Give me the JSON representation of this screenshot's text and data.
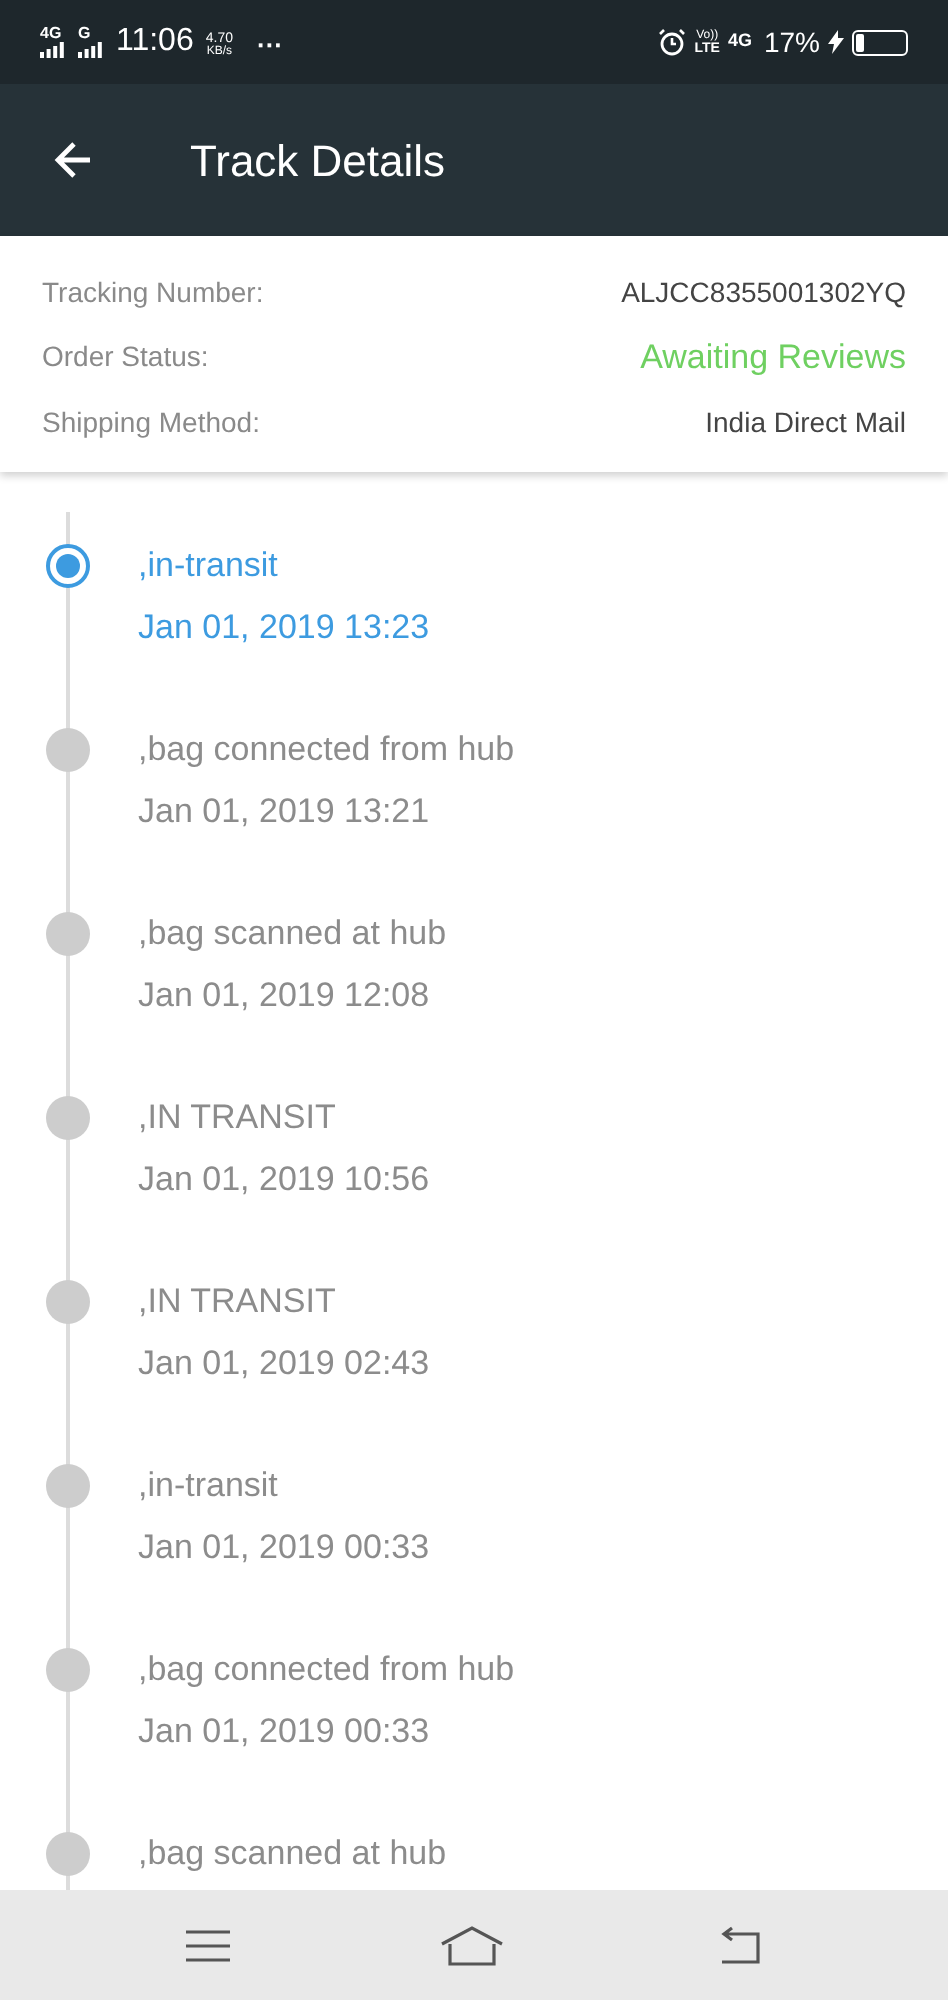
{
  "status_bar": {
    "sim1": "4G",
    "sim2": "G",
    "time": "11:06",
    "speed_value": "4.70",
    "speed_unit": "KB/s",
    "more": "···",
    "volte_top": "Vo))",
    "volte_bottom": "LTE",
    "network": "4G",
    "battery": "17%",
    "charging": true
  },
  "header": {
    "title": "Track Details"
  },
  "details": [
    {
      "label": "Tracking Number:",
      "value": "ALJCC8355001302YQ",
      "kind": "plain"
    },
    {
      "label": "Order Status:",
      "value": "Awaiting Reviews",
      "kind": "status"
    },
    {
      "label": "Shipping Method:",
      "value": "India Direct Mail",
      "kind": "plain"
    }
  ],
  "events": [
    {
      "title": ",in-transit",
      "time": "Jan 01, 2019 13:23",
      "selected": true
    },
    {
      "title": ",bag connected from hub",
      "time": "Jan 01, 2019 13:21",
      "selected": false
    },
    {
      "title": ",bag scanned at hub",
      "time": "Jan 01, 2019 12:08",
      "selected": false
    },
    {
      "title": ",IN TRANSIT",
      "time": "Jan 01, 2019 10:56",
      "selected": false
    },
    {
      "title": ",IN TRANSIT",
      "time": "Jan 01, 2019 02:43",
      "selected": false
    },
    {
      "title": ",in-transit",
      "time": "Jan 01, 2019 00:33",
      "selected": false
    },
    {
      "title": ",bag connected from hub",
      "time": "Jan 01, 2019 00:33",
      "selected": false
    },
    {
      "title": ",bag scanned at hub",
      "selected": false
    }
  ]
}
